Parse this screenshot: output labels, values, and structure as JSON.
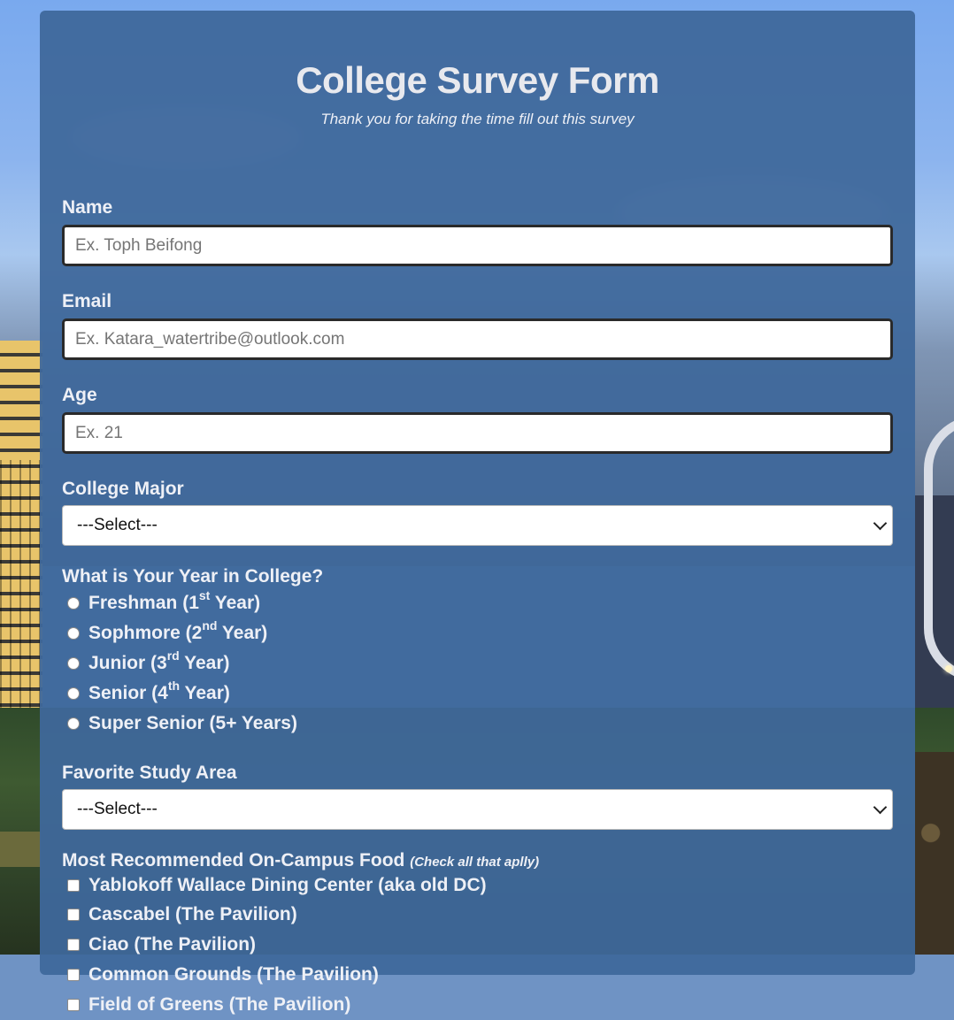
{
  "form": {
    "title": "College Survey Form",
    "subtitle": "Thank you for taking the time fill out this survey"
  },
  "fields": {
    "name": {
      "label": "Name",
      "placeholder": "Ex. Toph Beifong",
      "value": ""
    },
    "email": {
      "label": "Email",
      "placeholder": "Ex. Katara_watertribe@outlook.com",
      "value": ""
    },
    "age": {
      "label": "Age",
      "placeholder": "Ex. 21",
      "value": ""
    },
    "major": {
      "label": "College Major",
      "selected": "---Select---"
    },
    "year": {
      "label": "What is Your Year in College?",
      "options": [
        {
          "pre": "Freshman (1",
          "sup": "st",
          "post": " Year)",
          "checked": false
        },
        {
          "pre": "Sophmore (2",
          "sup": "nd",
          "post": " Year)",
          "checked": false
        },
        {
          "pre": "Junior (3",
          "sup": "rd",
          "post": " Year)",
          "checked": false
        },
        {
          "pre": "Senior (4",
          "sup": "th",
          "post": " Year)",
          "checked": false
        },
        {
          "pre": "Super Senior (5+ Years)",
          "sup": "",
          "post": "",
          "checked": false
        }
      ]
    },
    "study_area": {
      "label": "Favorite Study Area",
      "selected": "---Select---"
    },
    "food": {
      "label": "Most Recommended On-Campus Food",
      "hint": "(Check all that aplly)",
      "options": [
        {
          "label": "Yablokoff Wallace Dining Center (aka old DC)",
          "checked": false
        },
        {
          "label": "Cascabel (The Pavilion)",
          "checked": false
        },
        {
          "label": "Ciao (The Pavilion)",
          "checked": false
        },
        {
          "label": "Common Grounds (The Pavilion)",
          "checked": false
        },
        {
          "label": "Field of Greens (The Pavilion)",
          "checked": false
        }
      ]
    }
  },
  "colors": {
    "panel": "#3f689b",
    "text": "#eef0f6",
    "sky": "#79a9ee"
  }
}
